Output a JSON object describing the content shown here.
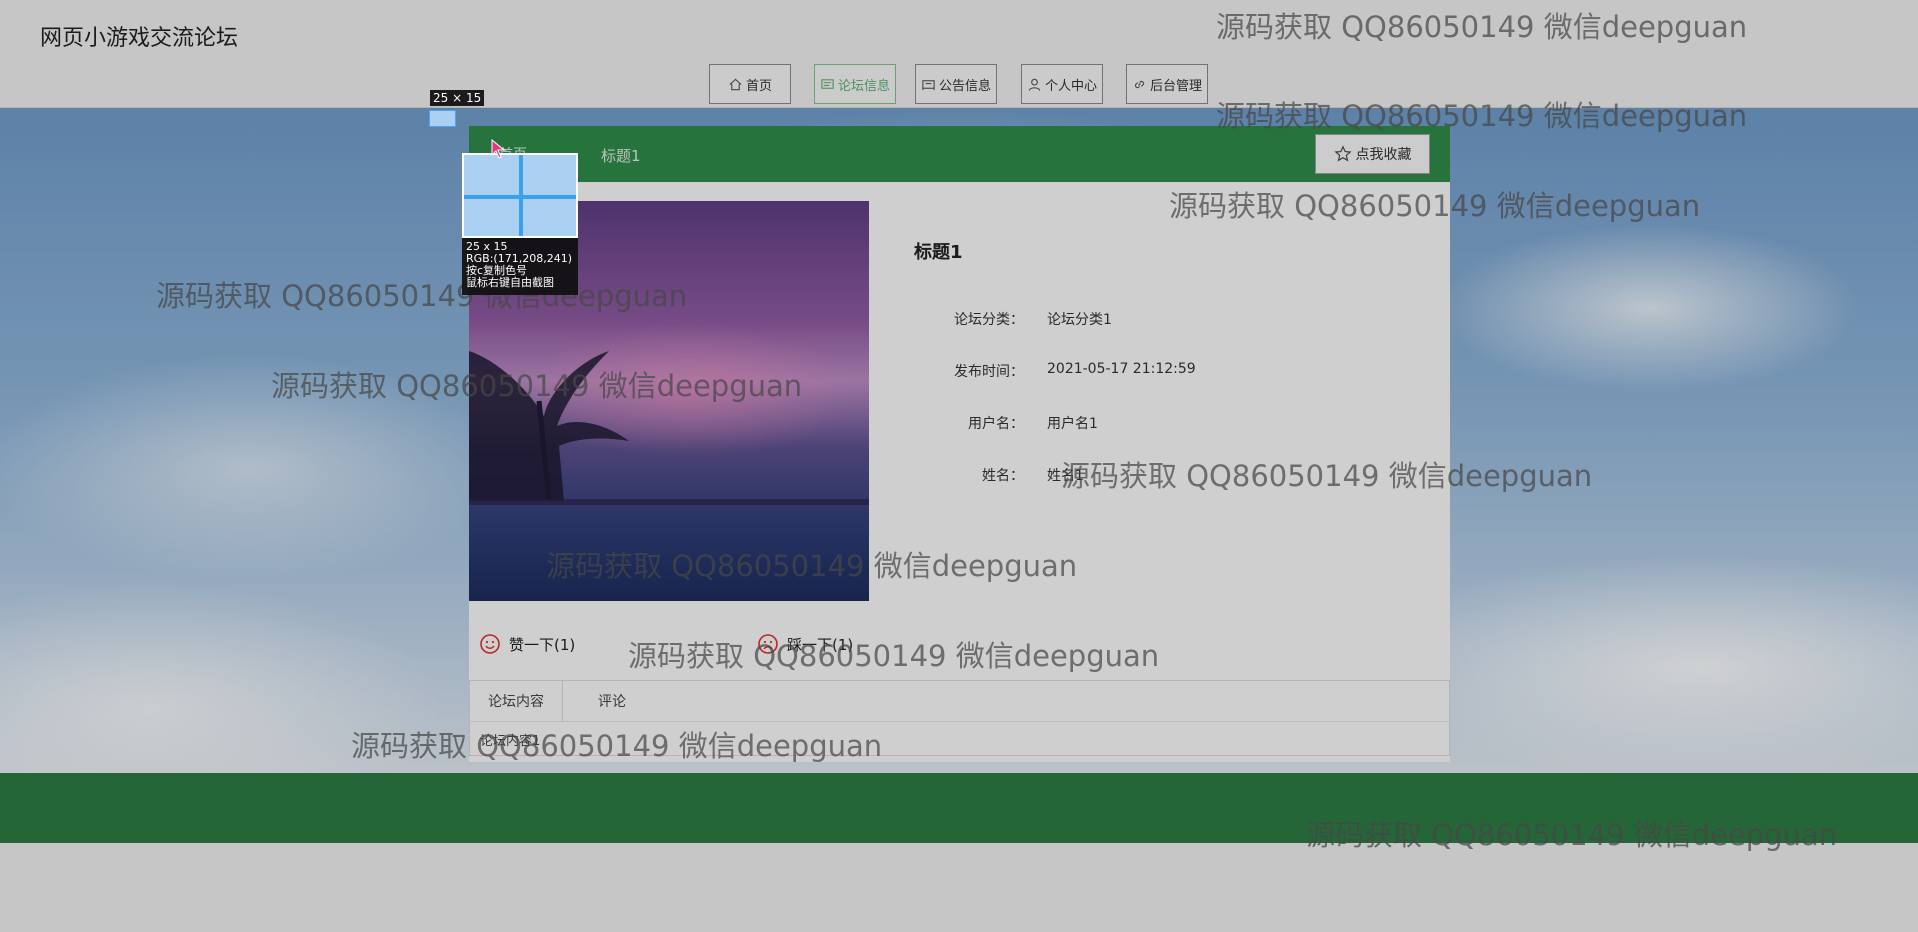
{
  "site": {
    "title": "网页小游戏交流论坛"
  },
  "nav": [
    {
      "label": "首页",
      "icon": "home-icon"
    },
    {
      "label": "论坛信息",
      "icon": "forum-icon",
      "active": true
    },
    {
      "label": "公告信息",
      "icon": "notice-icon"
    },
    {
      "label": "个人中心",
      "icon": "user-icon"
    },
    {
      "label": "后台管理",
      "icon": "link-icon"
    }
  ],
  "post": {
    "breadcrumb_home": "首页",
    "breadcrumb_current": "标题1",
    "favorite_label": "点我收藏",
    "title": "标题1",
    "fields": [
      {
        "label": "论坛分类：",
        "value": "论坛分类1"
      },
      {
        "label": "发布时间：",
        "value": "2021-05-17 21:12:59"
      },
      {
        "label": "用户名：",
        "value": "用户名1"
      },
      {
        "label": "姓名：",
        "value": "姓名1"
      }
    ],
    "like_label": "赞一下(1)",
    "dislike_label": "踩一下(1)",
    "tabs": [
      {
        "label": "论坛内容"
      },
      {
        "label": "评论"
      }
    ],
    "tab_content": "论坛内容1"
  },
  "screenshot_tool": {
    "size_label": "25 × 15",
    "info_size": "25 x 15",
    "info_rgb": "RGB:(171,208,241)",
    "info_copy": "按c复制色号",
    "info_hint": "鼠标右键自由截图"
  },
  "watermark": "源码获取 QQ86050149 微信deepguan",
  "colors": {
    "header_green": "#2f8a4b",
    "footer_green": "#2d7a43",
    "picked_color": "#abd0f1"
  }
}
